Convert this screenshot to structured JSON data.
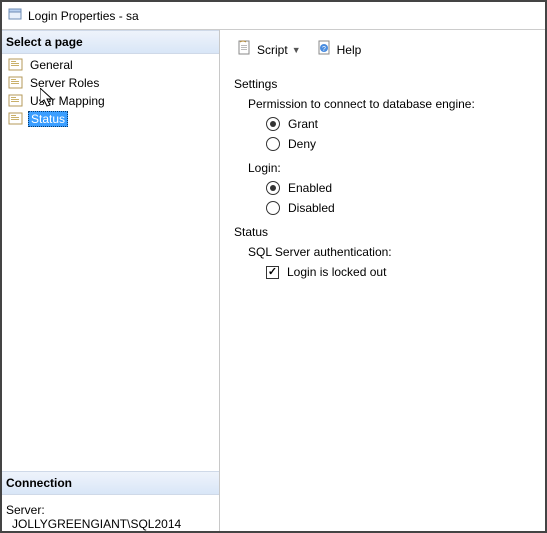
{
  "window": {
    "title": "Login Properties - sa"
  },
  "sidebar": {
    "select_page_label": "Select a page",
    "items": [
      {
        "label": "General"
      },
      {
        "label": "Server Roles"
      },
      {
        "label": "User Mapping"
      },
      {
        "label": "Status"
      }
    ],
    "connection_header": "Connection",
    "server_label": "Server:",
    "server_value": "JOLLYGREENGIANT\\SQL2014"
  },
  "toolbar": {
    "script_label": "Script",
    "help_label": "Help"
  },
  "content": {
    "settings_label": "Settings",
    "permission_label": "Permission to connect to database engine:",
    "permission_options": {
      "grant": "Grant",
      "deny": "Deny"
    },
    "login_label": "Login:",
    "login_options": {
      "enabled": "Enabled",
      "disabled": "Disabled"
    },
    "status_label": "Status",
    "sql_auth_label": "SQL Server authentication:",
    "locked_out_label": "Login is locked out"
  }
}
